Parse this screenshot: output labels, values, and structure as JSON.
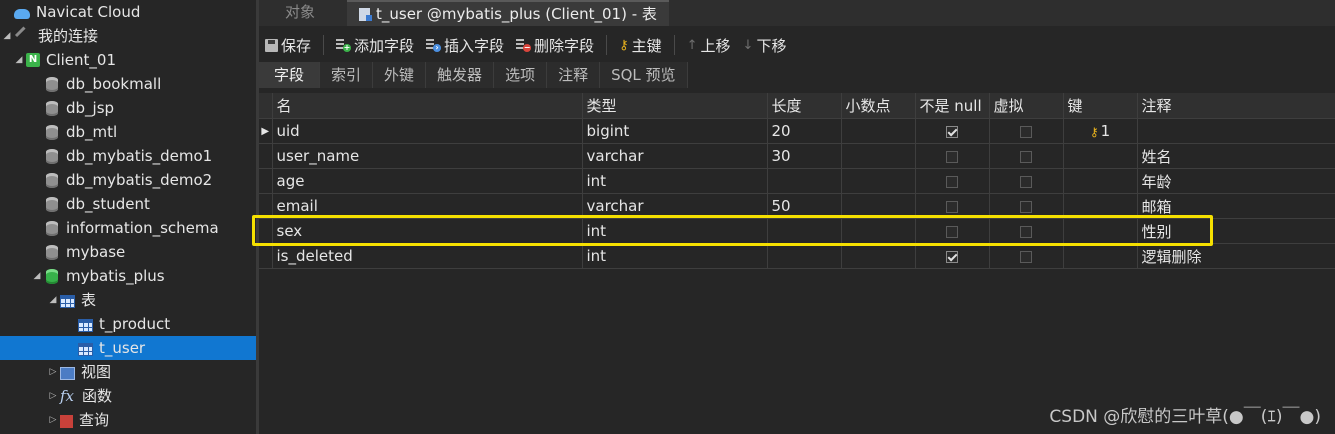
{
  "sidebar": {
    "items": [
      {
        "label": "Navicat Cloud",
        "icon": "cloud-icon",
        "level": 0,
        "expand": ""
      },
      {
        "label": "我的连接",
        "icon": "plug-icon",
        "level": 0,
        "expand": "◢"
      },
      {
        "label": "Client_01",
        "icon": "connection-icon",
        "level": 1,
        "expand": "◢"
      },
      {
        "label": "db_bookmall",
        "icon": "database-icon",
        "level": 2,
        "expand": ""
      },
      {
        "label": "db_jsp",
        "icon": "database-icon",
        "level": 2,
        "expand": ""
      },
      {
        "label": "db_mtl",
        "icon": "database-icon",
        "level": 2,
        "expand": ""
      },
      {
        "label": "db_mybatis_demo1",
        "icon": "database-icon",
        "level": 2,
        "expand": ""
      },
      {
        "label": "db_mybatis_demo2",
        "icon": "database-icon",
        "level": 2,
        "expand": ""
      },
      {
        "label": "db_student",
        "icon": "database-icon",
        "level": 2,
        "expand": ""
      },
      {
        "label": "information_schema",
        "icon": "database-icon",
        "level": 2,
        "expand": ""
      },
      {
        "label": "mybase",
        "icon": "database-icon",
        "level": 2,
        "expand": ""
      },
      {
        "label": "mybatis_plus",
        "icon": "database-open-icon",
        "level": 2,
        "expand": "◢"
      },
      {
        "label": "表",
        "icon": "table-folder-icon",
        "level": 3,
        "expand": "◢"
      },
      {
        "label": "t_product",
        "icon": "table-icon",
        "level": 4,
        "expand": ""
      },
      {
        "label": "t_user",
        "icon": "table-icon",
        "level": 4,
        "expand": "",
        "selected": true
      },
      {
        "label": "视图",
        "icon": "view-icon",
        "level": 3,
        "expand": "▷"
      },
      {
        "label": "函数",
        "icon": "function-icon",
        "level": 3,
        "expand": "▷"
      },
      {
        "label": "查询",
        "icon": "query-icon",
        "level": 3,
        "expand": "▷"
      }
    ]
  },
  "tabs": {
    "objects": "对象",
    "active": "t_user @mybatis_plus (Client_01) - 表"
  },
  "toolbar": {
    "save": "保存",
    "add_field": "添加字段",
    "insert_field": "插入字段",
    "delete_field": "删除字段",
    "primary_key": "主键",
    "move_up": "上移",
    "move_down": "下移"
  },
  "subtabs": [
    "字段",
    "索引",
    "外键",
    "触发器",
    "选项",
    "注释",
    "SQL 预览"
  ],
  "grid": {
    "headers": {
      "name": "名",
      "type": "类型",
      "length": "长度",
      "decimals": "小数点",
      "not_null": "不是 null",
      "virtual": "虚拟",
      "key": "键",
      "comment": "注释"
    },
    "rows": [
      {
        "name": "uid",
        "type": "bigint",
        "length": "20",
        "decimals": "",
        "not_null": true,
        "virtual": false,
        "key": "1",
        "comment": ""
      },
      {
        "name": "user_name",
        "type": "varchar",
        "length": "30",
        "decimals": "",
        "not_null": false,
        "virtual": false,
        "key": "",
        "comment": "姓名"
      },
      {
        "name": "age",
        "type": "int",
        "length": "",
        "decimals": "",
        "not_null": false,
        "virtual": false,
        "key": "",
        "comment": "年龄"
      },
      {
        "name": "email",
        "type": "varchar",
        "length": "50",
        "decimals": "",
        "not_null": false,
        "virtual": false,
        "key": "",
        "comment": "邮箱"
      },
      {
        "name": "sex",
        "type": "int",
        "length": "",
        "decimals": "",
        "not_null": false,
        "virtual": false,
        "key": "",
        "comment": "性别"
      },
      {
        "name": "is_deleted",
        "type": "int",
        "length": "",
        "decimals": "",
        "not_null": true,
        "virtual": false,
        "key": "",
        "comment": "逻辑删除"
      }
    ]
  },
  "watermark": "CSDN @欣慰的三叶草(●￣(ｴ)￣●)",
  "colors": {
    "selection": "#1177d1",
    "highlight": "#f5e000",
    "key": "#e8b21d"
  }
}
